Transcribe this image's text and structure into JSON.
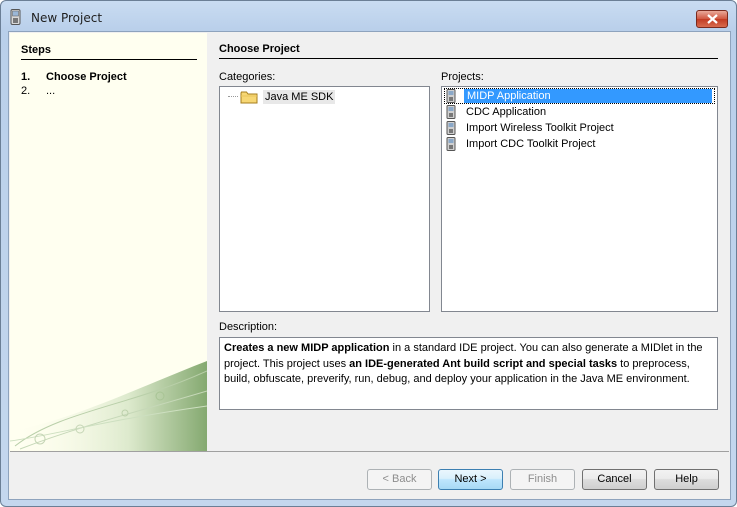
{
  "window": {
    "title": "New Project"
  },
  "steps": {
    "heading": "Steps",
    "items": [
      {
        "num": "1.",
        "label": "Choose Project"
      },
      {
        "num": "2.",
        "label": "..."
      }
    ]
  },
  "main": {
    "heading": "Choose Project",
    "categories_label": "Categories:",
    "categories": [
      "Java ME SDK"
    ],
    "projects_label": "Projects:",
    "projects": [
      {
        "label": "MIDP Application",
        "selected": true
      },
      {
        "label": "CDC Application",
        "selected": false
      },
      {
        "label": "Import Wireless Toolkit Project",
        "selected": false
      },
      {
        "label": "Import CDC Toolkit Project",
        "selected": false
      }
    ],
    "description_label": "Description:",
    "description": {
      "bold1": "Creates a new MIDP application",
      "text1": " in a standard IDE project. You can also generate a MIDlet in the project. This project uses ",
      "bold2": "an IDE-generated Ant build script and special tasks",
      "text2": " to preprocess, build, obfuscate, preverify, run, debug, and deploy your application in the Java ME environment."
    }
  },
  "buttons": {
    "back": "< Back",
    "next": "Next >",
    "finish": "Finish",
    "cancel": "Cancel",
    "help": "Help"
  }
}
